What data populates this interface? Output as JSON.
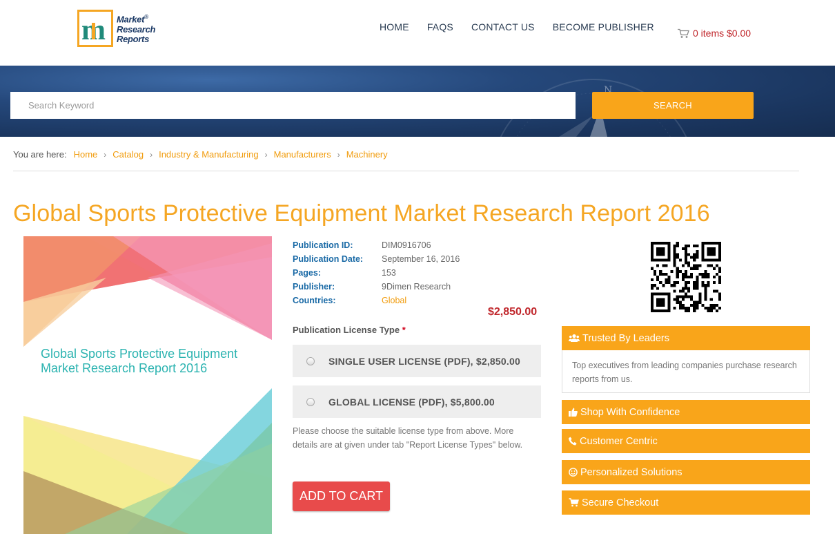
{
  "header": {
    "logo_line1": "Market",
    "logo_line2": "Research",
    "logo_line3": "Reports",
    "logo_reg": "®",
    "nav": [
      {
        "label": "HOME"
      },
      {
        "label": "FAQS"
      },
      {
        "label": "CONTACT US"
      },
      {
        "label": "BECOME PUBLISHER"
      }
    ],
    "cart_text": "0 items $0.00"
  },
  "search": {
    "placeholder": "Search Keyword",
    "button_label": "SEARCH"
  },
  "breadcrumb": {
    "lead": "You are here:",
    "items": [
      "Home",
      "Catalog",
      "Industry & Manufacturing",
      "Manufacturers",
      "Machinery"
    ]
  },
  "report": {
    "title": "Global Sports Protective Equipment Market Research Report 2016",
    "cover_title": "Global Sports Protective Equipment Market Research Report 2016",
    "details": [
      {
        "key": "Publication ID:",
        "value": "DIM0916706"
      },
      {
        "key": "Publication Date:",
        "value": "September 16, 2016"
      },
      {
        "key": "Pages:",
        "value": "153"
      },
      {
        "key": "Publisher:",
        "value": "9Dimen Research"
      },
      {
        "key": "Countries:",
        "value": "Global"
      }
    ],
    "price": "$2,850.00",
    "license_label": "Publication License Type",
    "license_required": "*",
    "licenses": [
      {
        "label": "SINGLE USER LICENSE (PDF), $2,850.00"
      },
      {
        "label": "GLOBAL LICENSE (PDF), $5,800.00"
      }
    ],
    "license_note": "Please choose the suitable license type from above. More details are at given under tab \"Report License Types\" below.",
    "add_to_cart": "ADD TO CART"
  },
  "sidebar": {
    "trusted_title": "Trusted By Leaders",
    "trusted_body": "Top executives from leading companies purchase research reports from us.",
    "shop": "Shop With Confidence",
    "centric": "Customer Centric",
    "personal": "Personalized Solutions",
    "secure": "Secure Checkout"
  },
  "colors": {
    "accent": "#f9a51a",
    "title": "#f5a623",
    "link": "#f19c0d",
    "price": "#c0262b",
    "cart_button": "#e84b4b",
    "banner": "#25487b"
  }
}
